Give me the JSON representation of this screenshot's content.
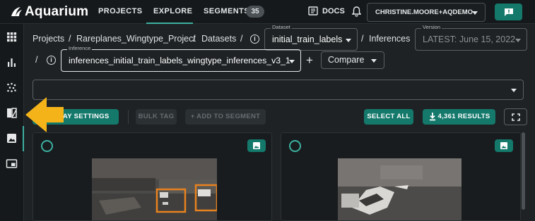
{
  "app": {
    "logo_text": "Aquarium"
  },
  "topnav": {
    "items": [
      {
        "label": "PROJECTS"
      },
      {
        "label": "EXPLORE",
        "active": true
      },
      {
        "label": "SEGMENTS",
        "count": "35"
      }
    ],
    "docs_label": "DOCS",
    "user_label": "CHRISTINE.MOORE+AQDEMO"
  },
  "sidebar": {
    "items": [
      "grid-icon",
      "bar-chart-icon",
      "scatter-icon",
      "compare-icon",
      "image-icon",
      "picture-in-picture-icon"
    ],
    "active": "image-icon"
  },
  "breadcrumb": {
    "projects": "Projects",
    "sep": "/",
    "project": "Rareplanes_Wingtype_Project",
    "datasets": "Datasets",
    "inferences": "Inferences"
  },
  "dataset_select": {
    "legend": "Dataset",
    "value": "initial_train_labels"
  },
  "version_select": {
    "legend": "Version",
    "value": "LATEST: June 15, 2022"
  },
  "inference_select": {
    "legend": "Inference",
    "value": "inferences_initial_train_labels_wingtype_inferences_v3_1"
  },
  "compare": {
    "label": "Compare"
  },
  "filter": {
    "placeholder": ""
  },
  "toolbar": {
    "display_settings_label": "DISPLAY SETTINGS",
    "bulk_tag_label": "BULK TAG",
    "add_to_segment_label": "+ ADD TO SEGMENT",
    "select_all_label": "SELECT ALL",
    "results_label": "4,361 RESULTS"
  },
  "colors": {
    "accent": "#14786b",
    "accent_light": "#3bb0a0",
    "box": "#e8821e",
    "arrow": "#f5b31a"
  }
}
